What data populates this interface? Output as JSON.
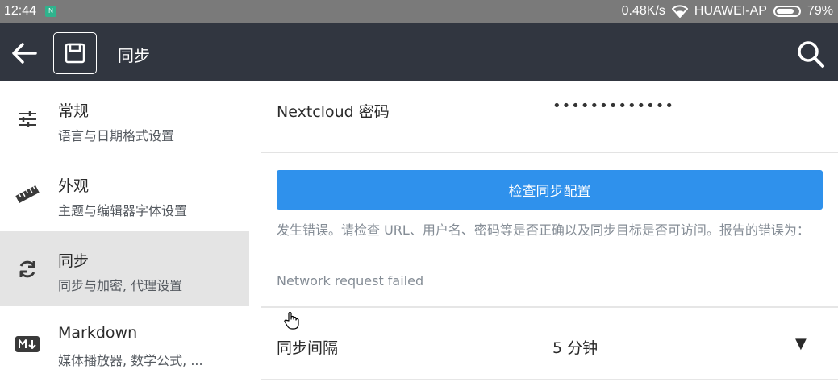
{
  "status_bar": {
    "time": "12:44",
    "speed": "0.48K/s",
    "network": "HUAWEI-AP",
    "battery": "79%",
    "battery_level": 0.79
  },
  "toolbar": {
    "back_icon": "arrow-left-icon",
    "save_icon": "floppy-disk-icon",
    "title": "同步",
    "search_icon": "search-icon"
  },
  "sidebar": {
    "items": [
      {
        "icon": "sliders-icon",
        "label": "常规",
        "desc": "语言与日期格式设置"
      },
      {
        "icon": "ruler-icon",
        "label": "外观",
        "desc": "主题与编辑器字体设置"
      },
      {
        "icon": "sync-icon",
        "label": "同步",
        "desc": "同步与加密, 代理设置",
        "selected": true
      },
      {
        "icon": "markdown-icon",
        "label": "Markdown",
        "desc": "媒体播放器, 数学公式, ..."
      }
    ]
  },
  "main": {
    "password_label": "Nextcloud 密码",
    "password_value": "•••••••••••••",
    "check_button": "检查同步配置",
    "error_text": "发生错误。请检查 URL、用户名、密码等是否正确以及同步目标是否可访问。报告的错误为：",
    "error_detail": "Network request failed",
    "interval_label": "同步间隔",
    "interval_value": "5 分钟",
    "interval_arrow": "▼"
  },
  "colors": {
    "status_bar": "#7a7a7a",
    "toolbar": "#313640",
    "accent": "#2f91ec",
    "selected": "#e4e4e4"
  }
}
